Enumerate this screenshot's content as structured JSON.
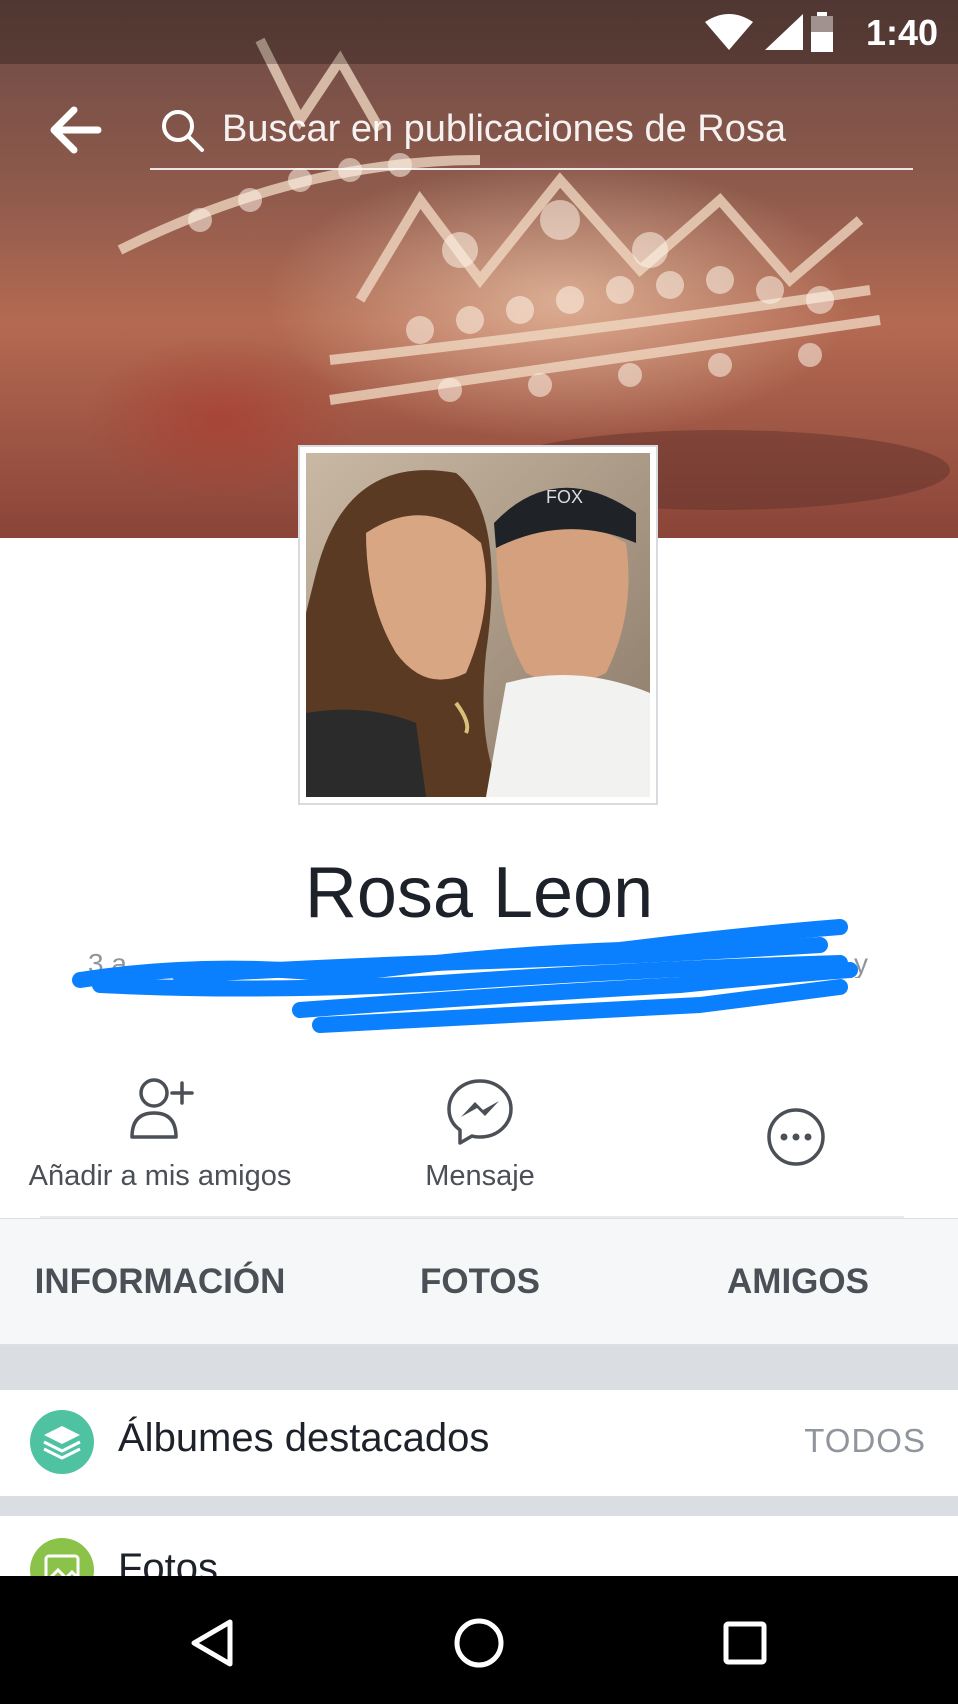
{
  "status_bar": {
    "time": "1:40"
  },
  "search": {
    "placeholder": "Buscar en publicaciones de Rosa"
  },
  "profile": {
    "name": "Rosa Leon",
    "bio_visible_fragment": "3 a",
    "bio_visible_end": "y",
    "photo_cap_text": "FOX"
  },
  "actions": {
    "add_friend": "Añadir a mis amigos",
    "message": "Mensaje"
  },
  "tabs": [
    "INFORMACIÓN",
    "FOTOS",
    "AMIGOS"
  ],
  "sections": {
    "albums_title": "Álbumes destacados",
    "albums_all": "TODOS",
    "photos_title": "Fotos"
  },
  "colors": {
    "scribble_blue": "#0a80ff",
    "albums_icon": "#4fc3a1",
    "photos_icon": "#8bc34a"
  }
}
